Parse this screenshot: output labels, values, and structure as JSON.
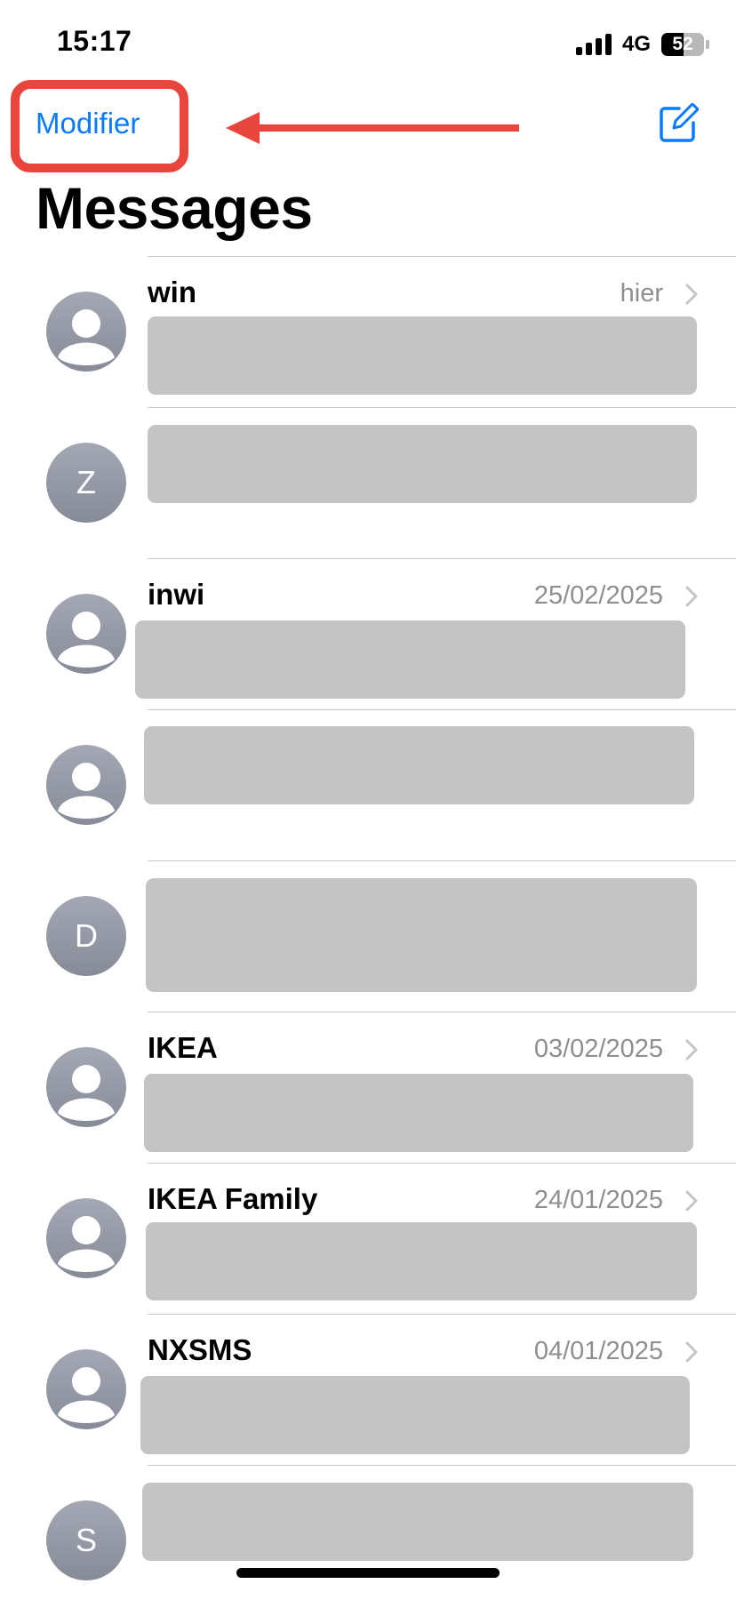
{
  "status_bar": {
    "time": "15:17",
    "network": "4G",
    "battery_percent": "52",
    "battery_level": 0.52
  },
  "nav": {
    "edit_label": "Modifier",
    "compose_icon": "compose-icon",
    "title": "Messages",
    "annotation_color": "#e8453c",
    "accent_color": "#0a7aff"
  },
  "conversations": [
    {
      "sender": "win",
      "date": "hier",
      "avatar": "person",
      "redacted": true
    },
    {
      "sender": "",
      "date": "",
      "avatar": "Z",
      "redacted": true
    },
    {
      "sender": "inwi",
      "date": "25/02/2025",
      "avatar": "person",
      "redacted": true
    },
    {
      "sender": "",
      "date": "",
      "avatar": "person",
      "redacted": true
    },
    {
      "sender": "",
      "date": "",
      "avatar": "D",
      "redacted": true
    },
    {
      "sender": "IKEA",
      "date": "03/02/2025",
      "avatar": "person",
      "redacted": true
    },
    {
      "sender": "IKEA Family",
      "date": "24/01/2025",
      "avatar": "person",
      "redacted": true
    },
    {
      "sender": "NXSMS",
      "date": "04/01/2025",
      "avatar": "person",
      "redacted": true
    },
    {
      "sender": "",
      "date": "",
      "avatar": "S",
      "redacted": true
    }
  ]
}
